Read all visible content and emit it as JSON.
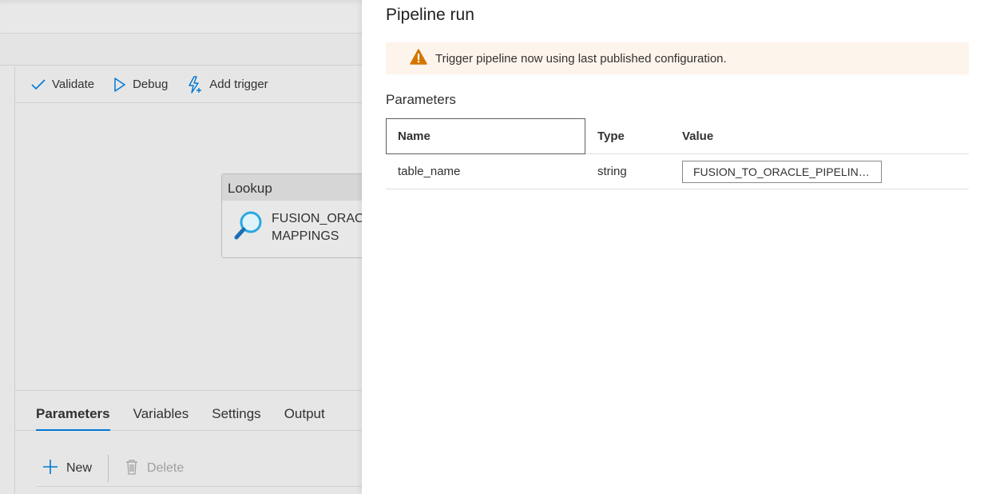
{
  "toolbar": {
    "validate_label": "Validate",
    "debug_label": "Debug",
    "add_trigger_label": "Add trigger"
  },
  "canvas": {
    "activity": {
      "type_label": "Lookup",
      "name_line1": "FUSION_ORAC",
      "name_line2": "MAPPINGS",
      "icon": "search-icon"
    }
  },
  "bottom_panel": {
    "tabs": [
      {
        "label": "Parameters",
        "active": true
      },
      {
        "label": "Variables",
        "active": false
      },
      {
        "label": "Settings",
        "active": false
      },
      {
        "label": "Output",
        "active": false
      }
    ],
    "new_label": "New",
    "delete_label": "Delete"
  },
  "pipeline_run": {
    "title": "Pipeline run",
    "banner_text": "Trigger pipeline now using last published configuration.",
    "banner_icon": "warning-icon",
    "section_label": "Parameters",
    "columns": {
      "name": "Name",
      "type": "Type",
      "value": "Value"
    },
    "rows": [
      {
        "name": "table_name",
        "type": "string",
        "value": "FUSION_TO_ORACLE_PIPELINE_MAPPINGS"
      }
    ]
  },
  "colors": {
    "accent": "#0078d4",
    "warning": "#d47500",
    "banner_bg": "#fdf4ec"
  }
}
